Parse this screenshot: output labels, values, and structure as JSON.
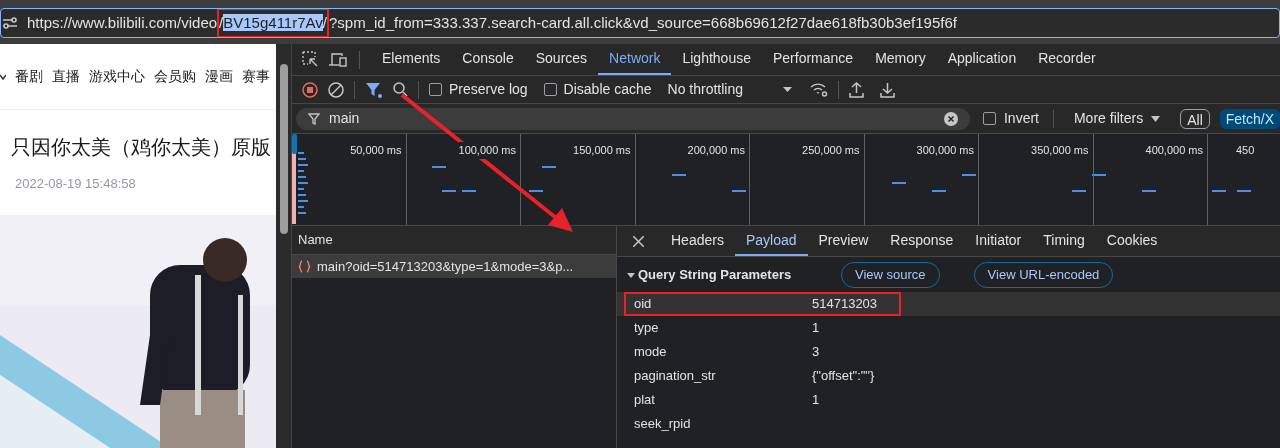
{
  "address_bar": {
    "segments": [
      {
        "text": "https://www.bilibili.com/video",
        "selected": false,
        "boxed": false
      },
      {
        "text": "/",
        "selected": false,
        "boxed": true
      },
      {
        "text": "BV15g411r7Av",
        "selected": true,
        "boxed": true
      },
      {
        "text": "/",
        "selected": false,
        "boxed": true
      },
      {
        "text": "?spm_id_from=333.337.search-card.all.click&vd_source=668b69612f27dae618fb30b3ef195f6f",
        "selected": false,
        "boxed": false
      }
    ]
  },
  "webpage": {
    "nav": [
      "番剧",
      "直播",
      "游戏中心",
      "会员购",
      "漫画",
      "赛事"
    ],
    "title": "只因你太美（鸡你太美）原版",
    "date": "2022-08-19 15:48:58",
    "video": {
      "kind": "picture"
    }
  },
  "devtools": {
    "tabs": [
      {
        "label": "Elements",
        "selected": false
      },
      {
        "label": "Console",
        "selected": false
      },
      {
        "label": "Sources",
        "selected": false
      },
      {
        "label": "Network",
        "selected": true
      },
      {
        "label": "Lighthouse",
        "selected": false
      },
      {
        "label": "Performance",
        "selected": false
      },
      {
        "label": "Memory",
        "selected": false
      },
      {
        "label": "Application",
        "selected": false
      },
      {
        "label": "Recorder",
        "selected": false
      }
    ],
    "toolbar": {
      "recording": true,
      "checkboxes": [
        {
          "label": "Preserve log",
          "checked": false
        },
        {
          "label": "Disable cache",
          "checked": false
        }
      ],
      "throttling": "No throttling"
    },
    "filter": {
      "value": "main",
      "invert": {
        "label": "Invert",
        "checked": false
      },
      "more_filters": "More filters",
      "types": [
        {
          "label": "All",
          "selected": false
        },
        {
          "label": "Fetch/X",
          "selected": true
        }
      ]
    },
    "overview": {
      "ticks": [
        "50,000 ms",
        "100,000 ms",
        "150,000 ms",
        "200,000 ms",
        "250,000 ms",
        "300,000 ms",
        "350,000 ms",
        "400,000 ms",
        "450"
      ]
    },
    "requests": {
      "column": "Name",
      "rows": [
        {
          "name": "main?oid=514713203&type=1&mode=3&p...",
          "selected": true
        }
      ]
    },
    "detail": {
      "tabs": [
        {
          "label": "Headers",
          "selected": false
        },
        {
          "label": "Payload",
          "selected": true
        },
        {
          "label": "Preview",
          "selected": false
        },
        {
          "label": "Response",
          "selected": false
        },
        {
          "label": "Initiator",
          "selected": false
        },
        {
          "label": "Timing",
          "selected": false
        },
        {
          "label": "Cookies",
          "selected": false
        }
      ],
      "section": {
        "title": "Query String Parameters",
        "expanded": true,
        "buttons": [
          "View source",
          "View URL-encoded"
        ],
        "params": [
          {
            "key": "oid",
            "value": "514713203",
            "highlighted": true
          },
          {
            "key": "type",
            "value": "1",
            "highlighted": false
          },
          {
            "key": "mode",
            "value": "3",
            "highlighted": false
          },
          {
            "key": "pagination_str",
            "value": "{\"offset\":\"\"}",
            "highlighted": false
          },
          {
            "key": "plat",
            "value": "1",
            "highlighted": false
          },
          {
            "key": "seek_rpid",
            "highlighted": false
          }
        ]
      }
    }
  }
}
